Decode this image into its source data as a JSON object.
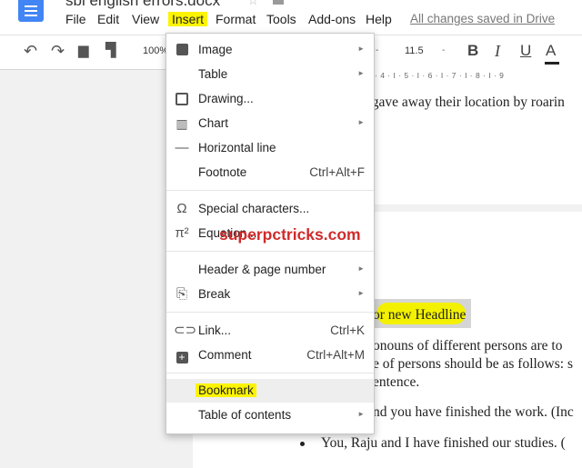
{
  "header": {
    "doc_title": "sbi english errors.docx",
    "saved_status": "All changes saved in Drive"
  },
  "menu": [
    "File",
    "Edit",
    "View",
    "Insert",
    "Format",
    "Tools",
    "Add-ons",
    "Help"
  ],
  "toolbar": {
    "zoom": "100%",
    "font_size": "11.5",
    "bold": "B",
    "italic": "I",
    "underline": "U",
    "text_color": "A"
  },
  "ruler": "3 · I · 4 · I · 5 · I · 6 · I · 7 · I · 8 · I · 9",
  "document": {
    "line1": "e gave away their location by roarin",
    "headline": "or new Headline",
    "para1": "onouns of different persons are to",
    "para2": "e of persons should be as follows: s",
    "para3": "entence.",
    "para4": "nd you have finished the work. (Inc",
    "bullet1": "You, Raju and I have finished our studies. ("
  },
  "watermark": "superpctricks.com",
  "insert_menu": {
    "image": "Image",
    "table": "Table",
    "drawing": "Drawing...",
    "chart": "Chart",
    "horizontal_line": "Horizontal line",
    "footnote": "Footnote",
    "footnote_shortcut": "Ctrl+Alt+F",
    "special_characters": "Special characters...",
    "equation": "Equation...",
    "header_page_number": "Header & page number",
    "break": "Break",
    "link": "Link...",
    "link_shortcut": "Ctrl+K",
    "comment": "Comment",
    "comment_shortcut": "Ctrl+Alt+M",
    "bookmark": "Bookmark",
    "table_of_contents": "Table of contents"
  },
  "colors": {
    "highlight": "#fcf400",
    "docs_blue": "#4285f4",
    "watermark": "#d02b2b"
  }
}
